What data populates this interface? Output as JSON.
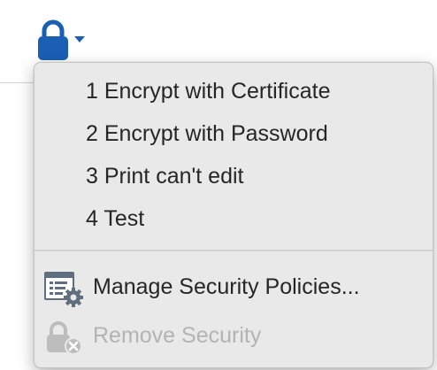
{
  "toolbar": {
    "security_icon": "lock-icon",
    "dropdown_icon": "caret-down-icon",
    "accent_color": "#1a5fb4"
  },
  "menu": {
    "policies": [
      {
        "label": "1 Encrypt with Certificate"
      },
      {
        "label": "2 Encrypt with Password"
      },
      {
        "label": "3 Print can't edit"
      },
      {
        "label": "4 Test"
      }
    ],
    "manage": {
      "label": "Manage Security Policies...",
      "icon": "security-policy-settings-icon"
    },
    "remove": {
      "label": "Remove Security",
      "icon": "lock-remove-icon",
      "disabled": true
    }
  }
}
